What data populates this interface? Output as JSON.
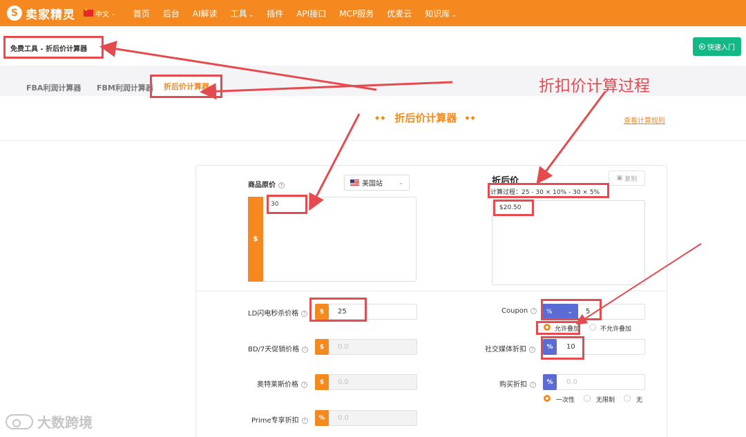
{
  "brand": {
    "logo_glyph": "S",
    "name": "卖家精灵"
  },
  "lang": {
    "label": "中文"
  },
  "nav": [
    {
      "label": "首页",
      "dropdown": false
    },
    {
      "label": "后台",
      "dropdown": false
    },
    {
      "label": "AI解读",
      "dropdown": false
    },
    {
      "label": "工具",
      "dropdown": true
    },
    {
      "label": "插件",
      "dropdown": false
    },
    {
      "label": "API接口",
      "dropdown": false
    },
    {
      "label": "MCP服务",
      "dropdown": false
    },
    {
      "label": "优麦云",
      "dropdown": false
    },
    {
      "label": "知识库",
      "dropdown": true
    }
  ],
  "breadcrumb": "免费工具 - 折后价计算器",
  "quick_start": "快速入门",
  "tabs": [
    "FBA利润计算器",
    "FBM利润计算器",
    "折后价计算器"
  ],
  "section": {
    "title": "折后价计算器",
    "rules_link": "查看计算规则"
  },
  "form": {
    "original_price_label": "商品原价",
    "site": "美国站",
    "currency_symbol": "$",
    "percent_symbol": "%",
    "original_price": "30",
    "after_label": "折后价",
    "copy": "复制",
    "process": "计算过程：25 - 30 × 10% - 30 × 5%",
    "result": "$20.50",
    "ld_label": "LD闪电秒杀价格",
    "ld_value": "25",
    "bd_label": "BD/7天促销价格",
    "bd_placeholder": "0.0",
    "outlet_label": "奥特莱斯价格",
    "outlet_placeholder": "0.0",
    "prime_label": "Prime专享折扣",
    "prime_placeholder": "0.0",
    "coupon_label": "Coupon",
    "coupon_type": "%",
    "coupon_value": "5",
    "stack_allow": "允许叠加",
    "stack_deny": "不允许叠加",
    "social_label": "社交媒体折扣",
    "social_value": "10",
    "purchase_label": "购买折扣",
    "purchase_placeholder": "0.0",
    "purchase_opts": [
      "一次性",
      "无限制",
      "无"
    ]
  },
  "annotation": {
    "caption": "折扣价计算过程",
    "color": "#e54a4f"
  },
  "watermark": "大数跨境",
  "colors": {
    "primary": "#f5891f",
    "accent_blue": "#5b6bd4",
    "green": "#13b886"
  }
}
